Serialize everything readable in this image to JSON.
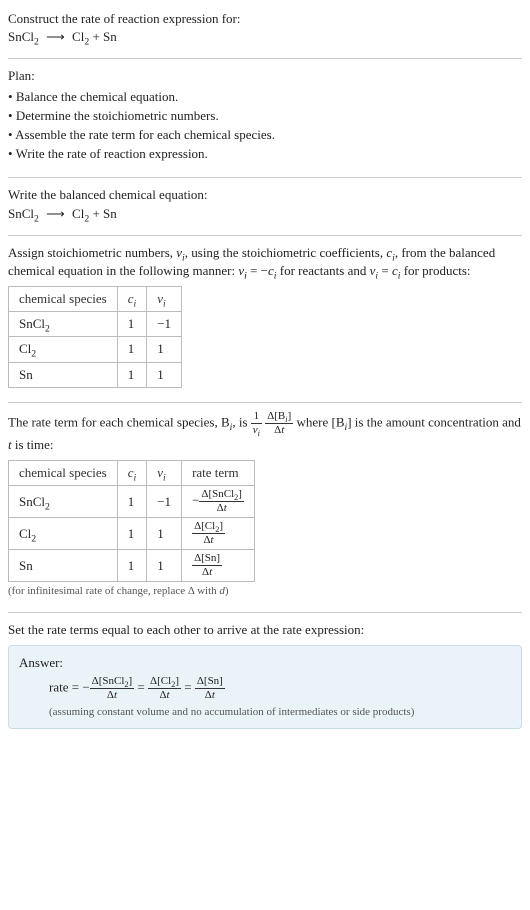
{
  "prompt": {
    "line1": "Construct the rate of reaction expression for:",
    "equation_html": "SnCl<sub>2</sub> <span class='arrow'>⟶</span> Cl<sub>2</sub> + Sn"
  },
  "plan": {
    "heading": "Plan:",
    "items": [
      "Balance the chemical equation.",
      "Determine the stoichiometric numbers.",
      "Assemble the rate term for each chemical species.",
      "Write the rate of reaction expression."
    ]
  },
  "balanced": {
    "heading": "Write the balanced chemical equation:",
    "equation_html": "SnCl<sub>2</sub> <span class='arrow'>⟶</span> Cl<sub>2</sub> + Sn"
  },
  "stoich": {
    "intro_html": "Assign stoichiometric numbers, <span class='ital'>ν<sub>i</sub></span>, using the stoichiometric coefficients, <span class='ital'>c<sub>i</sub></span>, from the balanced chemical equation in the following manner: <span class='ital'>ν<sub>i</sub></span> = −<span class='ital'>c<sub>i</sub></span> for reactants and <span class='ital'>ν<sub>i</sub></span> = <span class='ital'>c<sub>i</sub></span> for products:",
    "headers": {
      "species": "chemical species",
      "ci_html": "<span class='ital'>c<sub>i</sub></span>",
      "vi_html": "<span class='ital'>ν<sub>i</sub></span>"
    },
    "rows": [
      {
        "species_html": "SnCl<sub>2</sub>",
        "ci": "1",
        "vi": "−1"
      },
      {
        "species_html": "Cl<sub>2</sub>",
        "ci": "1",
        "vi": "1"
      },
      {
        "species_html": "Sn",
        "ci": "1",
        "vi": "1"
      }
    ]
  },
  "rateterm": {
    "intro_html": "The rate term for each chemical species, B<sub><span class='ital'>i</span></sub>, is <span class='frac'><span class='num'>1</span><span class='den'><span class='ital'>ν<sub>i</sub></span></span></span> <span class='frac'><span class='num'>Δ[B<sub><span class='ital'>i</span></sub>]</span><span class='den'>Δ<span class='ital'>t</span></span></span> where [B<sub><span class='ital'>i</span></sub>] is the amount concentration and <span class='ital'>t</span> is time:",
    "headers": {
      "species": "chemical species",
      "ci_html": "<span class='ital'>c<sub>i</sub></span>",
      "vi_html": "<span class='ital'>ν<sub>i</sub></span>",
      "rate": "rate term"
    },
    "rows": [
      {
        "species_html": "SnCl<sub>2</sub>",
        "ci": "1",
        "vi": "−1",
        "rate_html": "−<span class='frac'><span class='num'>Δ[SnCl<sub>2</sub>]</span><span class='den'>Δ<span class='ital'>t</span></span></span>"
      },
      {
        "species_html": "Cl<sub>2</sub>",
        "ci": "1",
        "vi": "1",
        "rate_html": "<span class='frac'><span class='num'>Δ[Cl<sub>2</sub>]</span><span class='den'>Δ<span class='ital'>t</span></span></span>"
      },
      {
        "species_html": "Sn",
        "ci": "1",
        "vi": "1",
        "rate_html": "<span class='frac'><span class='num'>Δ[Sn]</span><span class='den'>Δ<span class='ital'>t</span></span></span>"
      }
    ],
    "note_html": "(for infinitesimal rate of change, replace Δ with <span class='ital'>d</span>)"
  },
  "final": {
    "heading": "Set the rate terms equal to each other to arrive at the rate expression:",
    "answer_label": "Answer:",
    "rate_html": "rate = −<span class='frac'><span class='num'>Δ[SnCl<sub>2</sub>]</span><span class='den'>Δ<span class='ital'>t</span></span></span> = <span class='frac'><span class='num'>Δ[Cl<sub>2</sub>]</span><span class='den'>Δ<span class='ital'>t</span></span></span> = <span class='frac'><span class='num'>Δ[Sn]</span><span class='den'>Δ<span class='ital'>t</span></span></span>",
    "note": "(assuming constant volume and no accumulation of intermediates or side products)"
  }
}
